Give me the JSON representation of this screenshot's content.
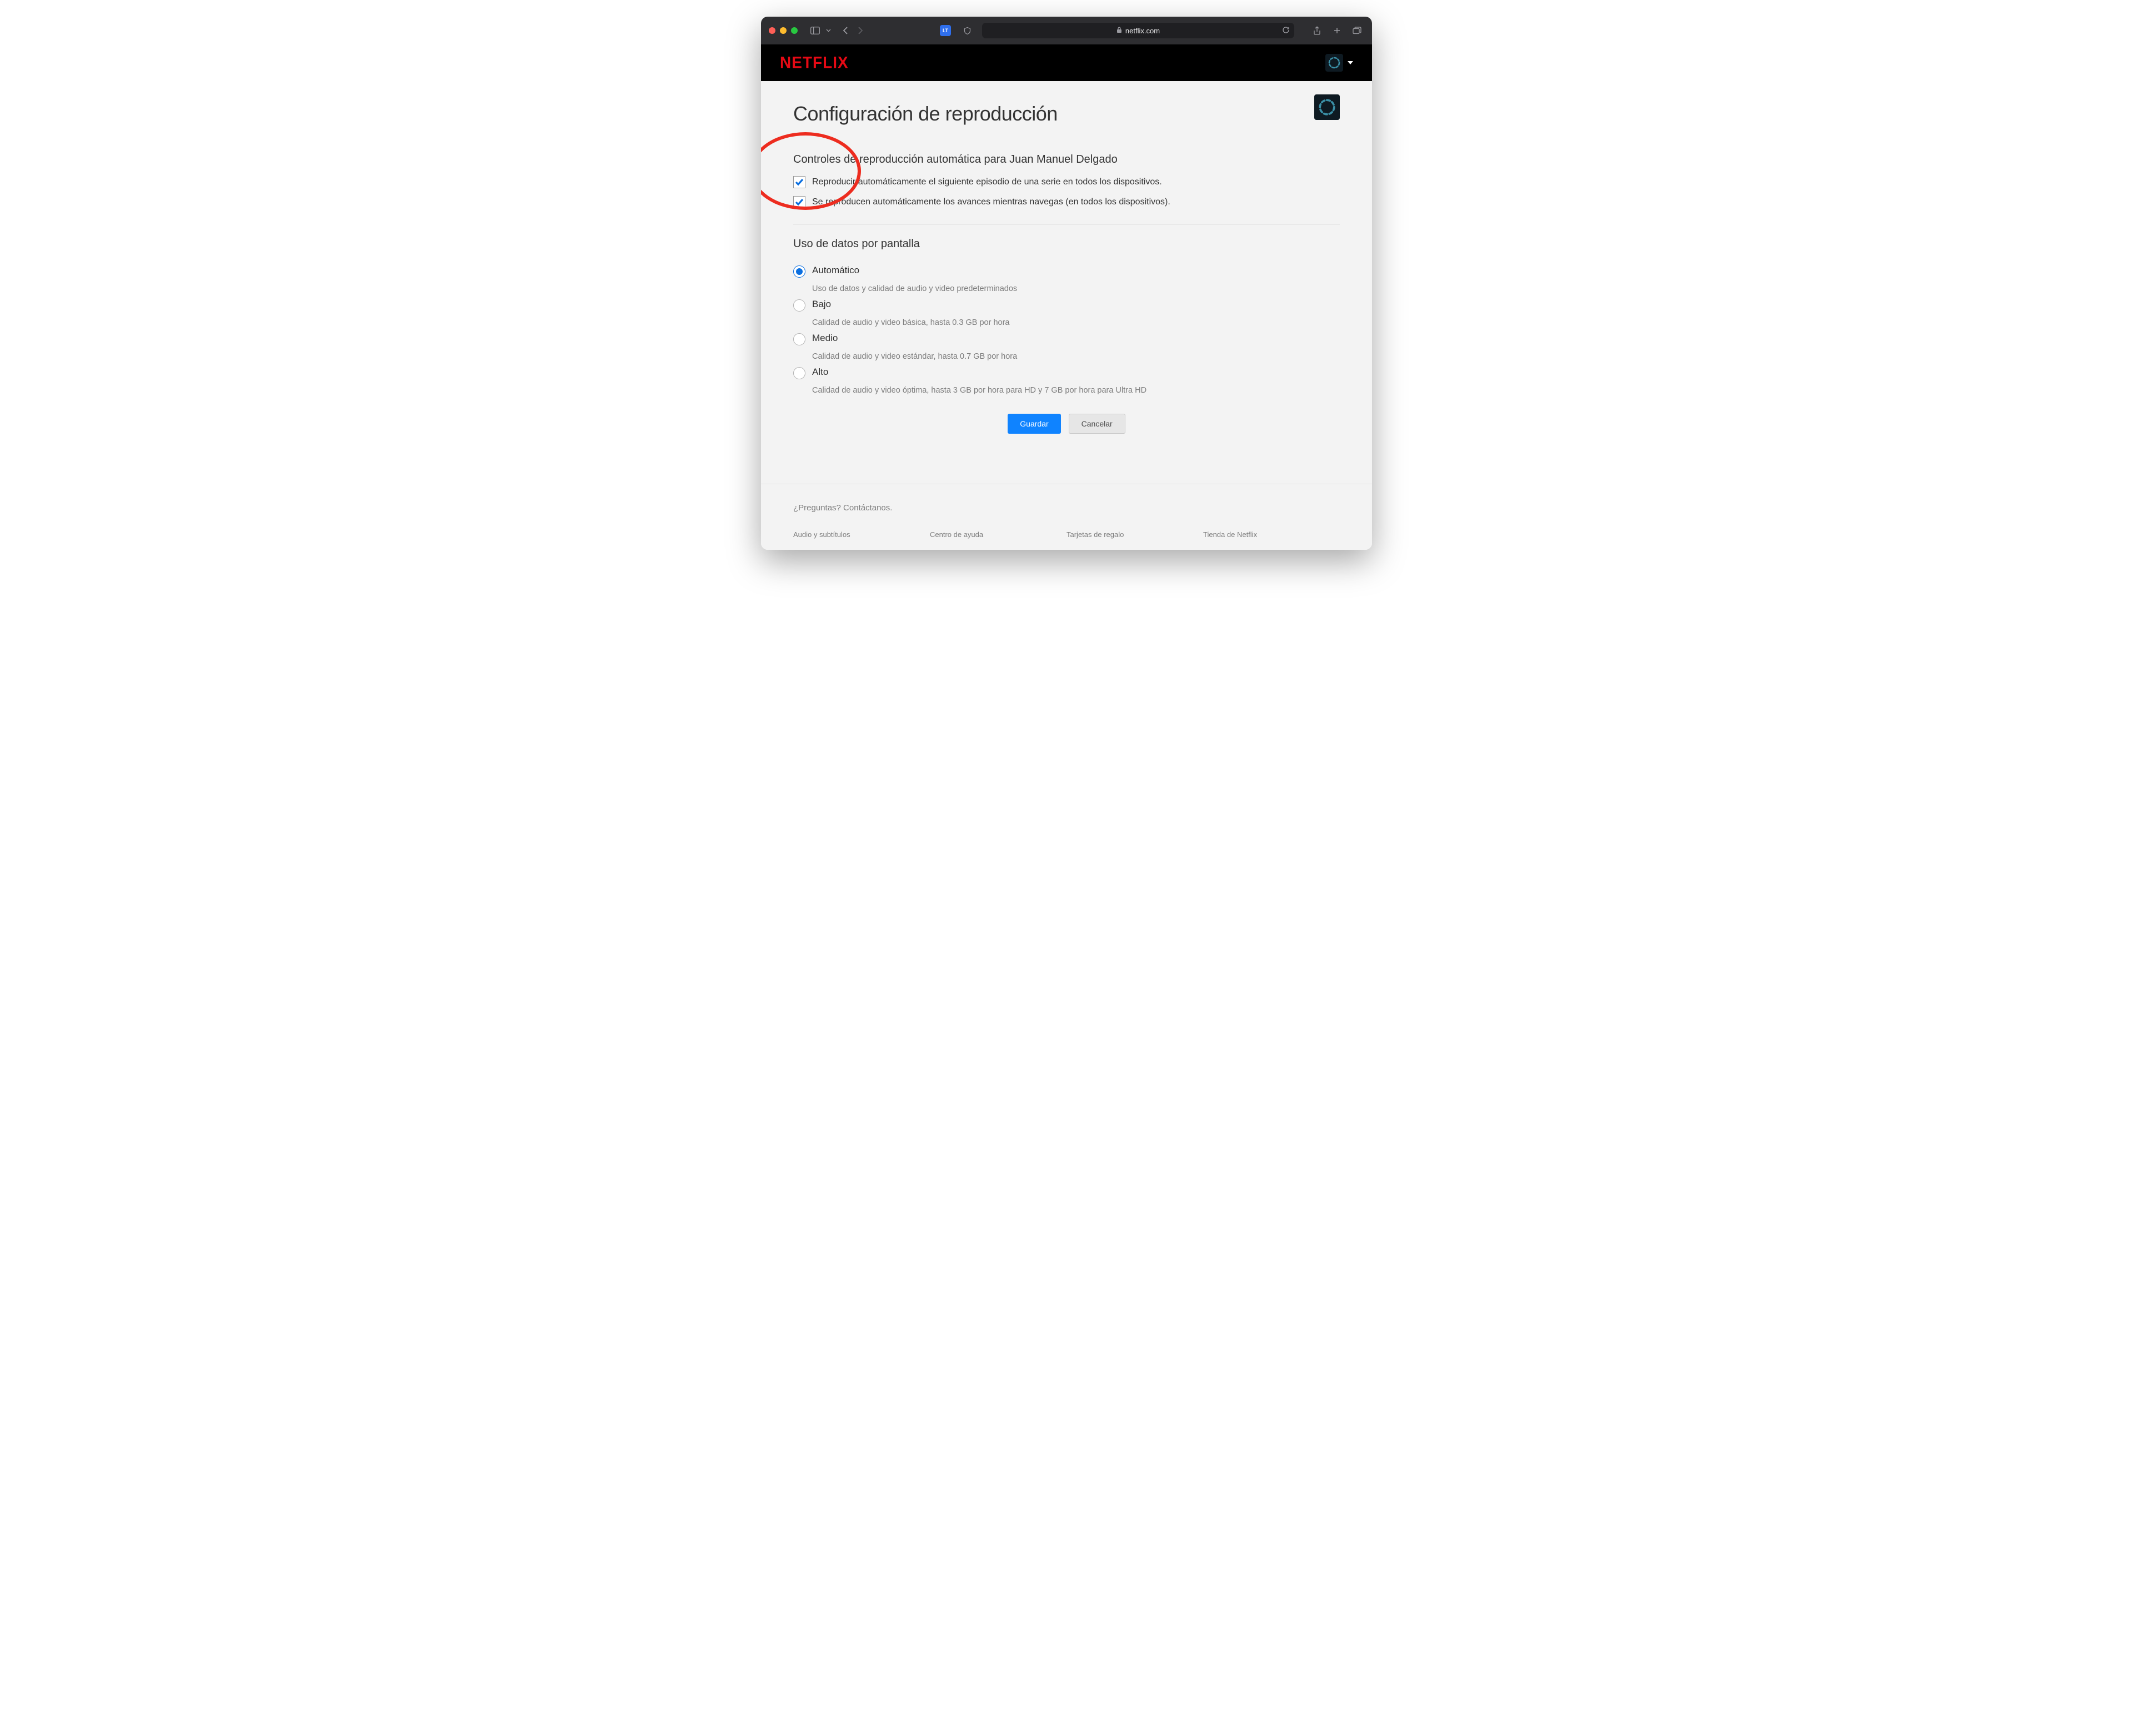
{
  "browser": {
    "url_display": "netflix.com"
  },
  "header": {
    "brand": "NETFLIX"
  },
  "page": {
    "title": "Configuración de reproducción",
    "autoplay_heading": "Controles de reproducción automática para Juan Manuel Delgado",
    "checkbox1": "Reproducir automáticamente el siguiente episodio de una serie en todos los dispositivos.",
    "checkbox2": "Se reproducen automáticamente los avances mientras navegas (en todos los dispositivos).",
    "data_heading": "Uso de datos por pantalla",
    "options": [
      {
        "label": "Automático",
        "desc": "Uso de datos y calidad de audio y video predeterminados",
        "checked": true
      },
      {
        "label": "Bajo",
        "desc": "Calidad de audio y video básica, hasta 0.3 GB por hora",
        "checked": false
      },
      {
        "label": "Medio",
        "desc": "Calidad de audio y video estándar, hasta 0.7 GB por hora",
        "checked": false
      },
      {
        "label": "Alto",
        "desc": "Calidad de audio y video óptima, hasta 3 GB por hora para HD y 7 GB por hora para Ultra HD",
        "checked": false
      }
    ],
    "save_label": "Guardar",
    "cancel_label": "Cancelar"
  },
  "footer": {
    "contact": "¿Preguntas? Contáctanos.",
    "links": [
      "Audio y subtítulos",
      "Centro de ayuda",
      "Tarjetas de regalo",
      "Tienda de Netflix"
    ]
  }
}
